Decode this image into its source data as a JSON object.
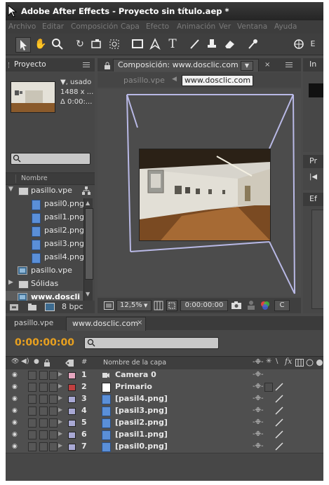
{
  "window": {
    "title": "Adobe After Effects - Proyecto sin título.aep *"
  },
  "menu": [
    "Archivo",
    "Editar",
    "Composición",
    "Capa",
    "Efecto",
    "Animación",
    "Ver",
    "Ventana",
    "Ayuda"
  ],
  "project_panel": {
    "tab_label": "Proyecto",
    "info_line1": "▼, usado",
    "info_line2": "1488 x ...",
    "info_line3": "Δ 0:00:...",
    "column_name": "Nombre",
    "items": [
      {
        "label": "pasillo.vpe",
        "type": "folder",
        "expanded": true
      },
      {
        "label": "pasil0.png",
        "type": "png"
      },
      {
        "label": "pasil1.png",
        "type": "png"
      },
      {
        "label": "pasil2.png",
        "type": "png"
      },
      {
        "label": "pasil3.png",
        "type": "png"
      },
      {
        "label": "pasil4.png",
        "type": "png"
      },
      {
        "label": "pasillo.vpe",
        "type": "comp"
      },
      {
        "label": "Sólidas",
        "type": "folder",
        "expanded": false
      },
      {
        "label": "www.doscli",
        "type": "comp"
      }
    ],
    "bpc": "8 bpc"
  },
  "comp_panel": {
    "tab_label": "Composición: www.dosclic.com",
    "breadcrumb_prev": "pasillo.vpe",
    "breadcrumb_current": "www.dosclic.com",
    "zoom": "12,5%",
    "timecode": "0:00:00:00",
    "channel_letter": "C"
  },
  "right_panel": {
    "tab1": "In",
    "tab2": "Pr",
    "tab3": "Ef"
  },
  "timeline": {
    "tabs": [
      "pasillo.vpe",
      "www.dosclic.com"
    ],
    "timecode": "0:00:00:00",
    "header_hash": "#",
    "header_name": "Nombre de la capa",
    "layers": [
      {
        "num": "1",
        "name": "Camera 0",
        "label_color": "#e6a7c0",
        "icon": "camera"
      },
      {
        "num": "2",
        "name": "Primario",
        "label_color": "#c04040",
        "icon": "solid"
      },
      {
        "num": "3",
        "name": "[pasil4.png]",
        "label_color": "#a9a9d4",
        "icon": "png"
      },
      {
        "num": "4",
        "name": "[pasil3.png]",
        "label_color": "#a9a9d4",
        "icon": "png"
      },
      {
        "num": "5",
        "name": "[pasil2.png]",
        "label_color": "#a9a9d4",
        "icon": "png"
      },
      {
        "num": "6",
        "name": "[pasil1.png]",
        "label_color": "#a9a9d4",
        "icon": "png"
      },
      {
        "num": "7",
        "name": "[pasil0.png]",
        "label_color": "#a9a9d4",
        "icon": "png"
      }
    ]
  },
  "colors": {
    "accent_timecode": "#e8a01f",
    "comp_wire": "#b9b9e6"
  }
}
